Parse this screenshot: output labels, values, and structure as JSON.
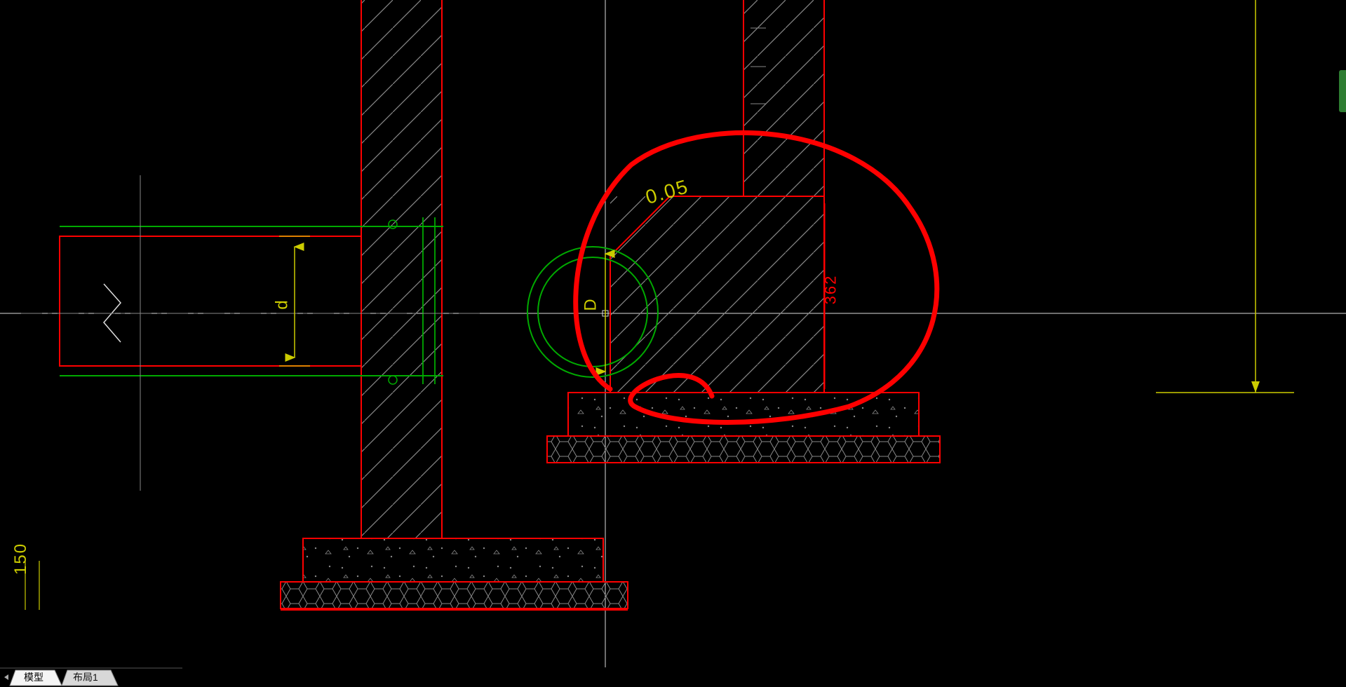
{
  "tabs": {
    "model": "模型",
    "layout1": "布局1"
  },
  "dims": {
    "left_thickness": "150",
    "d_label": "d",
    "D_label": "D",
    "annotation_value": "0.05",
    "footing_height": "362"
  }
}
